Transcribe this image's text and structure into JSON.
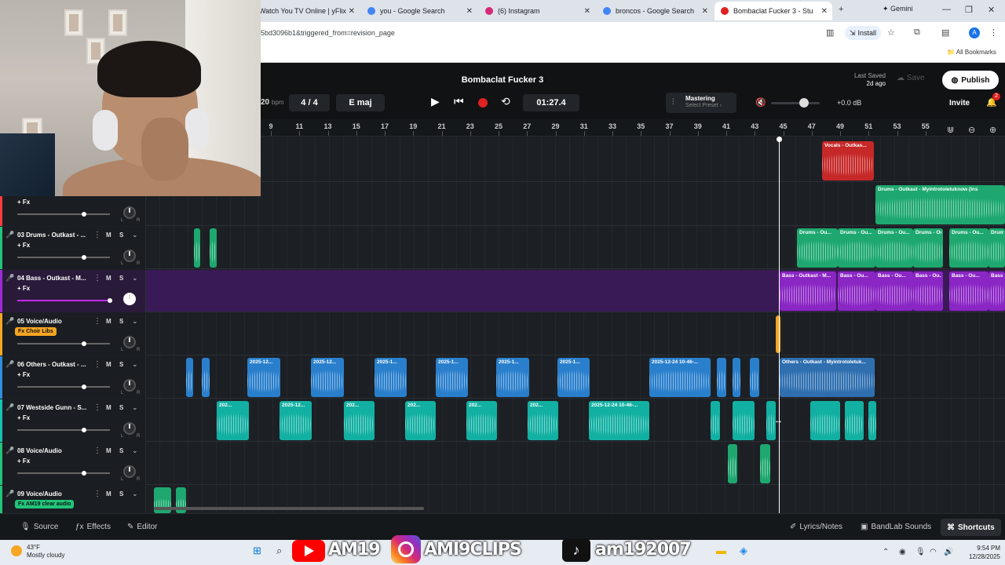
{
  "browser": {
    "tabs": [
      {
        "title": "Watch You TV Online | yFlix",
        "fav": "#888888"
      },
      {
        "title": "you - Google Search",
        "fav": "#4285f4"
      },
      {
        "title": "(6) Instagram",
        "fav": "#d62976"
      },
      {
        "title": "broncos - Google Search",
        "fav": "#4285f4"
      },
      {
        "title": "Bombaclat Fucker 3 - Stu",
        "fav": "#e02121"
      }
    ],
    "gemini": "✦ Gemini",
    "url": "5bd3096b1&triggered_from=revision_page",
    "install": "Install",
    "all_bookmarks": "All Bookmarks",
    "avatar_letter": "A"
  },
  "header": {
    "project_title": "Bombaclat Fucker 3",
    "last_saved_label": "Last Saved",
    "last_saved_value": "2d ago",
    "save": "Save",
    "publish": "Publish",
    "tempo_value": "20",
    "tempo_unit": "bpm",
    "time_signature": "4 / 4",
    "key": "E maj",
    "time": "01:27.4",
    "mastering_title": "Mastering",
    "mastering_sub": "Select Preset ›",
    "master_volume": "+0.0 dB",
    "master_volume_fraction": 0.58,
    "invite": "Invite",
    "notification_count": "2"
  },
  "ruler": {
    "ticks": [
      "9",
      "11",
      "13",
      "15",
      "17",
      "19",
      "21",
      "23",
      "25",
      "27",
      "29",
      "31",
      "33",
      "35",
      "37",
      "39",
      "41",
      "43",
      "45",
      "47",
      "49",
      "51",
      "53",
      "55"
    ]
  },
  "tracks": [
    {
      "name": "",
      "fx": "+ Fx",
      "fx_tag": "",
      "color": "#ff3b3b",
      "volume_fraction": 0.82,
      "mic": ""
    },
    {
      "name": "03 Drums - Outkast - ...",
      "fx": "+ Fx",
      "fx_tag": "",
      "color": "#21c47a",
      "volume_fraction": 0.82,
      "mic": "🎤"
    },
    {
      "name": "04 Bass - Outkast - M...",
      "fx": "+ Fx",
      "fx_tag": "",
      "color": "#9b2bd8",
      "volume_fraction": 0.98,
      "mic": "🎤"
    },
    {
      "name": "05 Voice/Audio",
      "fx": "",
      "fx_tag": "Fx Choir Libs",
      "fx_tag_color": "#f5a623",
      "color": "#f5a623",
      "volume_fraction": 0.82,
      "mic": "🎤"
    },
    {
      "name": "06 Others - Outkast - ...",
      "fx": "+ Fx",
      "fx_tag": "",
      "color": "#2f8fe0",
      "volume_fraction": 0.82,
      "mic": "🎤"
    },
    {
      "name": "07 Westside Gunn - S...",
      "fx": "+ Fx",
      "fx_tag": "",
      "color": "#14c4b4",
      "volume_fraction": 0.82,
      "mic": "🎤"
    },
    {
      "name": "08 Voice/Audio",
      "fx": "+ Fx",
      "fx_tag": "",
      "color": "#21c47a",
      "volume_fraction": 0.82,
      "mic": "🎤"
    },
    {
      "name": "09 Voice/Audio",
      "fx": "",
      "fx_tag": "Fx AM19 clear audio",
      "fx_tag_color": "#21c47a",
      "color": "#21c47a",
      "volume_fraction": 0.82,
      "mic": "🎤"
    }
  ],
  "clip_labels": {
    "vocals": "Vocals - Outkas...",
    "drums_long": "Drums - Outkast - Myintrotoletuknow (Ins",
    "drums_short": "Drums - Ou...",
    "bass_main": "Bass - Outkast - M...",
    "bass_short": "Bass - Ou...",
    "others_main": "Others - Outkast - Myintrotoletuk...",
    "date_long": "2025-12-24 10-46-...",
    "date_12": "2025-12...",
    "date_1": "2025-1...",
    "date_short": "202..."
  },
  "bottom_bar": {
    "source": "Source",
    "effects": "Effects",
    "editor": "Editor",
    "lyrics": "Lyrics/Notes",
    "sounds": "BandLab Sounds",
    "shortcuts": "Shortcuts"
  },
  "taskbar": {
    "temperature": "43°F",
    "weather": "Mostly cloudy",
    "time": "9:54 PM",
    "date": "12/28/2025",
    "overlay_yt": "AM19",
    "overlay_ig": "AMI9CLIPS",
    "overlay_tt": "am192007"
  },
  "colors": {
    "drums": "#21c47a",
    "bass": "#9b2bd8",
    "others": "#2f8fe0",
    "westside": "#14c4b4",
    "vocals": "#d42b2b",
    "voice": "#f5a623"
  }
}
